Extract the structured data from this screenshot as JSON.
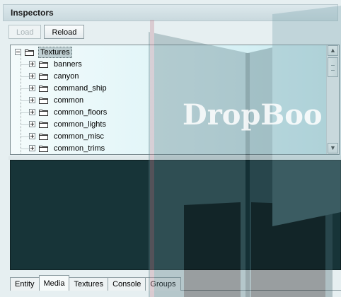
{
  "panel": {
    "title": "Inspectors"
  },
  "toolbar": {
    "load_label": "Load",
    "reload_label": "Reload"
  },
  "tree": {
    "root_label": "Textures",
    "items": [
      {
        "label": "banners"
      },
      {
        "label": "canyon"
      },
      {
        "label": "command_ship"
      },
      {
        "label": "common"
      },
      {
        "label": "common_floors"
      },
      {
        "label": "common_lights"
      },
      {
        "label": "common_misc"
      },
      {
        "label": "common_trims"
      }
    ]
  },
  "tabs": [
    {
      "label": "Entity"
    },
    {
      "label": "Media"
    },
    {
      "label": "Textures"
    },
    {
      "label": "Console"
    },
    {
      "label": "Groups"
    }
  ],
  "active_tab": "Media",
  "watermark": {
    "text": "DropBoo"
  },
  "colors": {
    "preview_background": "#173438",
    "tree_background": "#dff4f7",
    "selection": "#bfcfd2"
  },
  "icons": {
    "folder": "folder-icon",
    "expand": "plus-box-icon",
    "collapse": "minus-box-icon",
    "scroll_up": "arrow-up-icon",
    "scroll_down": "arrow-down-icon"
  }
}
